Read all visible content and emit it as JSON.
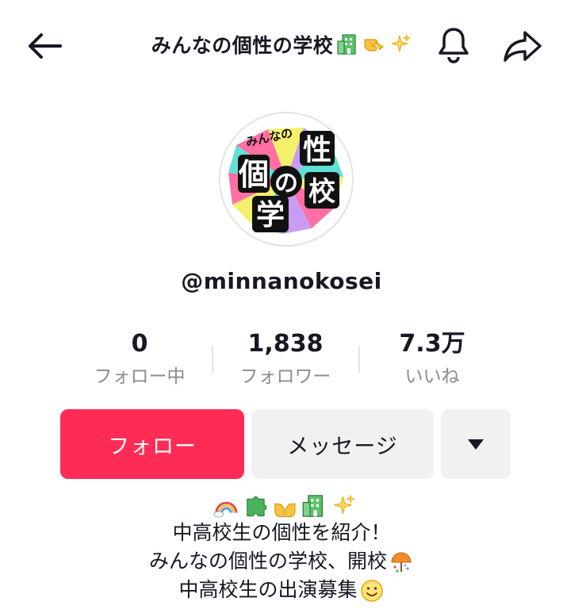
{
  "header": {
    "title": "みんなの個性の学校",
    "back_icon": "arrow-left-icon",
    "bell_icon": "bell-icon",
    "share_icon": "share-arrow-icon"
  },
  "avatar": {
    "logo_text": [
      "みんなの",
      "個",
      "性",
      "の",
      "学",
      "校"
    ]
  },
  "username": "@minnanokosei",
  "stats": [
    {
      "value": "0",
      "label": "フォロー中"
    },
    {
      "value": "1,838",
      "label": "フォロワー"
    },
    {
      "value": "7.3万",
      "label": "いいね"
    }
  ],
  "buttons": {
    "follow": "フォロー",
    "message": "メッセージ",
    "more_icon": "caret-down-icon"
  },
  "bio": {
    "icons": [
      "rainbow-icon",
      "puzzle-icon",
      "palms-icon",
      "school-icon",
      "sparkles-icon"
    ],
    "line1": "中高校生の個性を紹介！",
    "line2": "みんなの個性の学校、開校",
    "line3": "中高校生の出演募集"
  },
  "colors": {
    "accent": "#fe2c55",
    "button_grey": "#f1f1f2",
    "text": "#161823",
    "muted": "#8a8b91"
  }
}
